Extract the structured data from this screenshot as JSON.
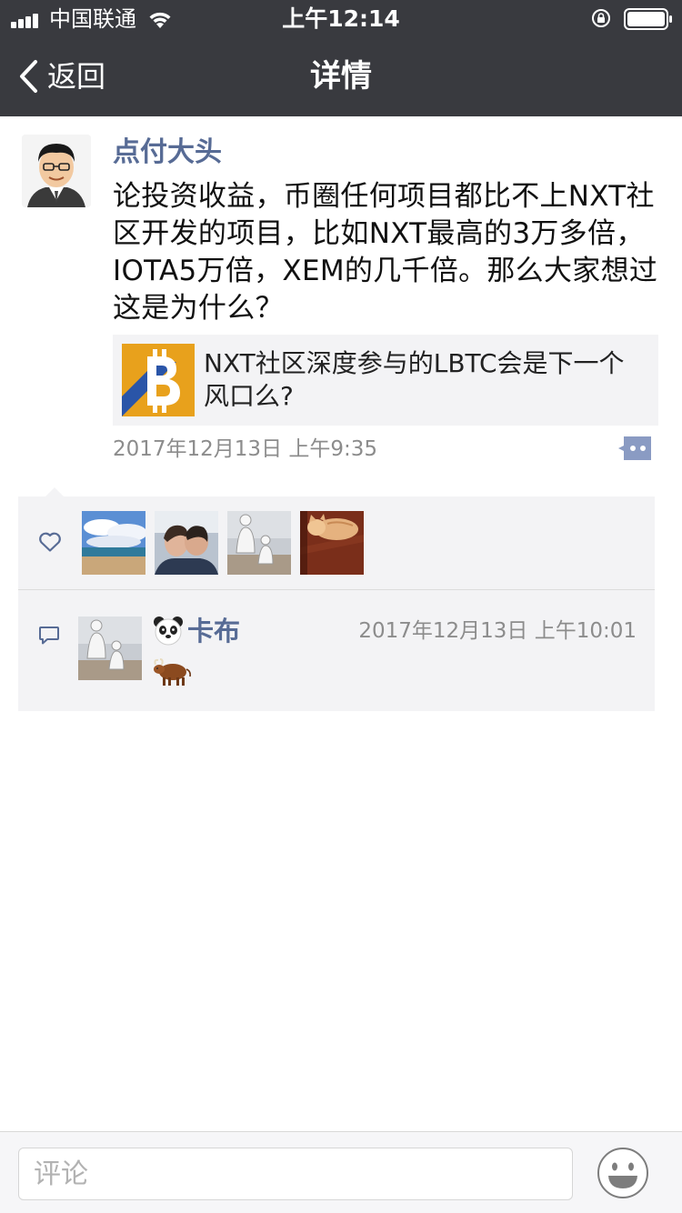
{
  "status_bar": {
    "carrier": "中国联通",
    "time": "上午12:14"
  },
  "nav": {
    "back_label": "返回",
    "title": "详情"
  },
  "post": {
    "author": "点付大头",
    "text": "论投资收益，币圈任何项目都比不上NXT社区开发的项目，比如NXT最高的3万多倍，IOTA5万倍，XEM的几千倍。那么大家想过这是为什么？",
    "link_card": {
      "title": "NXT社区深度参与的LBTC会是下一个风口么?",
      "thumb_icon": "bitcoin-logo-icon"
    },
    "timestamp": "2017年12月13日 上午9:35"
  },
  "likes": {
    "icon": "heart-icon",
    "avatars": [
      "beach-photo",
      "couple-photo",
      "sketch-figures",
      "sleeping-cat"
    ]
  },
  "comments": [
    {
      "author_emoji": "panda-emoji",
      "author": "卡布",
      "time": "2017年12月13日 上午10:01",
      "content_emoji": "ox-emoji"
    }
  ],
  "input": {
    "placeholder": "评论"
  },
  "colors": {
    "topbar": "#393a3f",
    "link_blue": "#576b95",
    "panel_bg": "#f3f3f5",
    "meta_gray": "#8c8c8c"
  }
}
